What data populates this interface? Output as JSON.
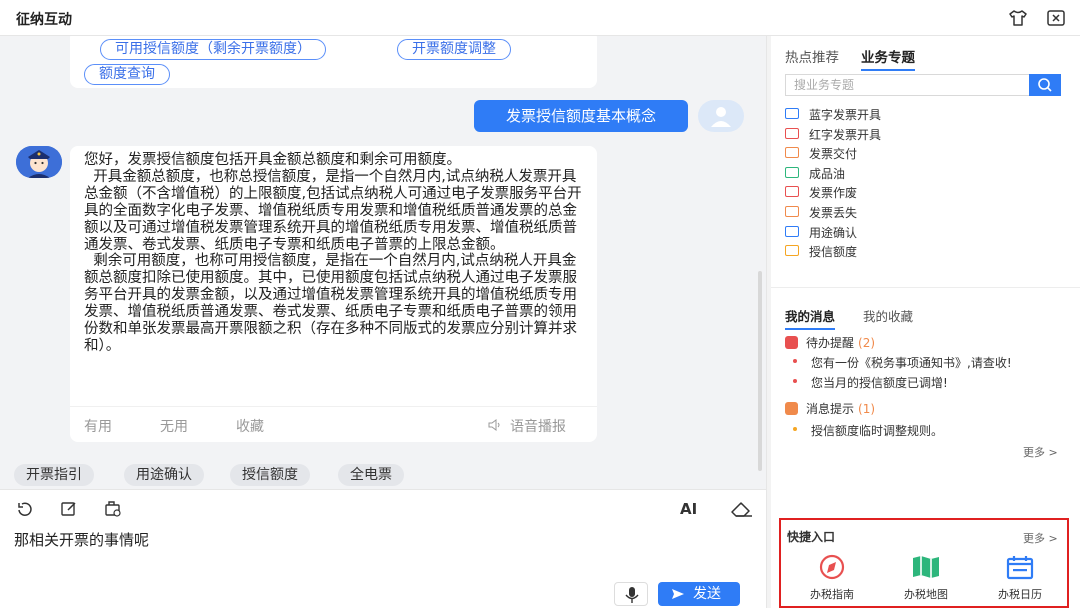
{
  "window": {
    "title": "征纳互动"
  },
  "chat": {
    "top_options": [
      "可用授信额度（剩余开票额度）",
      "开票额度调整",
      "额度查询"
    ],
    "user_message": "发票授信额度基本概念",
    "answer_paragraphs": [
      "您好，发票授信额度包括开具金额总额度和剩余可用额度。",
      "  开具金额总额度，也称总授信额度，是指一个自然月内,试点纳税人发票开具总金额（不含增值税）的上限额度,包括试点纳税人可通过电子发票服务平台开具的全面数字化电子发票、增值税纸质专用发票和增值税纸质普通发票的总金额以及可通过增值税发票管理系统开具的增值税纸质专用发票、增值税纸质普通发票、卷式发票、纸质电子专票和纸质电子普票的上限总金额。",
      "  剩余可用额度，也称可用授信额度，是指在一个自然月内,试点纳税人开具金额总额度扣除已使用额度。其中，已使用额度包括试点纳税人通过电子发票服务平台开具的发票金额，以及通过增值税发票管理系统开具的增值税纸质专用发票、增值税纸质普通发票、卷式发票、纸质电子专票和纸质电子普票的领用份数和单张发票最高开票限额之积（存在多种不同版式的发票应分别计算并求和）。"
    ],
    "feedback": {
      "useful": "有用",
      "useless": "无用",
      "favorite": "收藏",
      "voice": "语音播报"
    },
    "quick_chips": [
      "开票指引",
      "用途确认",
      "授信额度",
      "全电票"
    ]
  },
  "composer": {
    "ai_label": "AI",
    "draft_text": "那相关开票的事情呢",
    "send_label": "发送"
  },
  "sidebar": {
    "tabs": [
      "热点推荐",
      "业务专题"
    ],
    "search_placeholder": "搜业务专题",
    "topics": [
      {
        "label": "蓝字发票开具",
        "icon": "invoice-blue-icon",
        "color": "#2f7cf6"
      },
      {
        "label": "红字发票开具",
        "icon": "invoice-red-icon",
        "color": "#e85050"
      },
      {
        "label": "发票交付",
        "icon": "delivery-icon",
        "color": "#f08a4b"
      },
      {
        "label": "成品油",
        "icon": "oil-icon",
        "color": "#2db67c"
      },
      {
        "label": "发票作废",
        "icon": "void-icon",
        "color": "#e85050"
      },
      {
        "label": "发票丢失",
        "icon": "lost-icon",
        "color": "#f08a4b"
      },
      {
        "label": "用途确认",
        "icon": "confirm-icon",
        "color": "#2f7cf6"
      },
      {
        "label": "授信额度",
        "icon": "credit-icon",
        "color": "#f5a623"
      }
    ],
    "message_tabs": [
      "我的消息",
      "我的收藏"
    ],
    "todo": {
      "title": "待办提醒",
      "count": "(2)",
      "items": [
        "您有一份《税务事项通知书》,请查收!",
        "您当月的授信额度已调增!"
      ]
    },
    "notice": {
      "title": "消息提示",
      "count": "(1)",
      "items": [
        "授信额度临时调整规则。"
      ]
    },
    "more_label": "更多 >",
    "quick_entry": {
      "title": "快捷入口",
      "more_label": "更多 >",
      "items": [
        {
          "label": "办税指南",
          "icon": "compass-icon",
          "color": "#e85050"
        },
        {
          "label": "办税地图",
          "icon": "map-icon",
          "color": "#2db67c"
        },
        {
          "label": "办税日历",
          "icon": "calendar-icon",
          "color": "#2f7cf6"
        }
      ]
    }
  }
}
